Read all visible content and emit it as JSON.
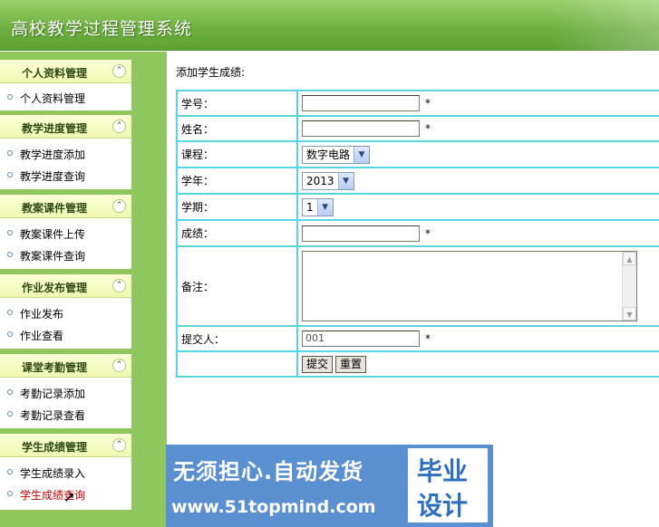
{
  "header": {
    "title": "高校教学过程管理系统"
  },
  "sidebar": {
    "groups": [
      {
        "title": "个人资料管理",
        "items": [
          "个人资料管理"
        ]
      },
      {
        "title": "教学进度管理",
        "items": [
          "教学进度添加",
          "教学进度查询"
        ]
      },
      {
        "title": "教案课件管理",
        "items": [
          "教案课件上传",
          "教案课件查询"
        ]
      },
      {
        "title": "作业发布管理",
        "items": [
          "作业发布",
          "作业查看"
        ]
      },
      {
        "title": "课堂考勤管理",
        "items": [
          "考勤记录添加",
          "考勤记录查看"
        ]
      },
      {
        "title": "学生成绩管理",
        "items": [
          "学生成绩录入",
          "学生成绩查询"
        ]
      }
    ],
    "collapse_glyph": "⌃"
  },
  "main": {
    "caption": "添加学生成绩:",
    "fields": {
      "student_id": {
        "label": "学号：",
        "value": ""
      },
      "name": {
        "label": "姓名：",
        "value": ""
      },
      "course": {
        "label": "课程：",
        "value": "数字电路"
      },
      "year": {
        "label": "学年：",
        "value": "2013"
      },
      "term": {
        "label": "学期：",
        "value": "1"
      },
      "score": {
        "label": "成绩：",
        "value": ""
      },
      "remark": {
        "label": "备注：",
        "value": ""
      },
      "submitter": {
        "label": "提交人：",
        "value": "001"
      }
    },
    "required_mark": "*",
    "buttons": {
      "submit": "提交",
      "reset": "重置"
    }
  },
  "watermark": {
    "line1": "无须担心.自动发货",
    "line2": "www.51topmind.com",
    "box_line1": "毕业",
    "box_line2": "设计"
  }
}
